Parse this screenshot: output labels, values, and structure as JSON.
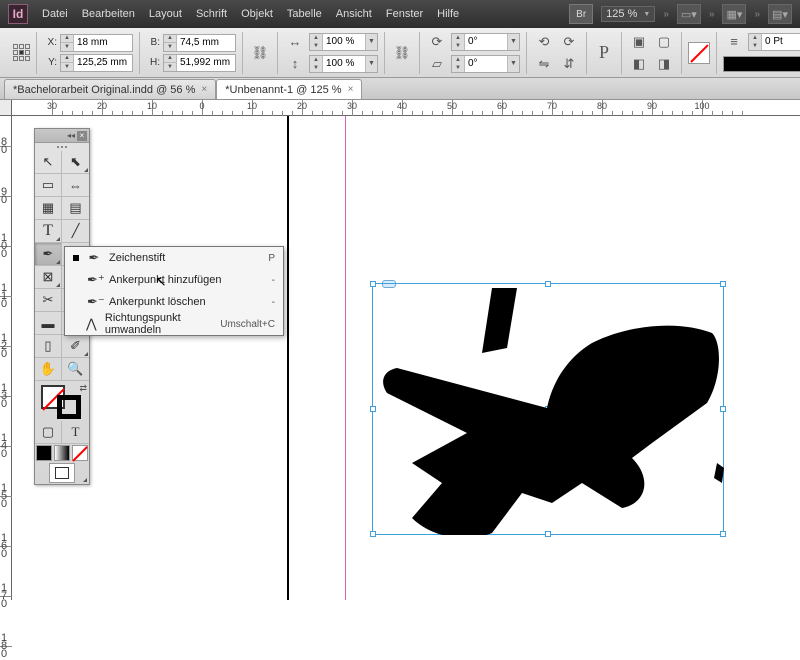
{
  "app": {
    "logo": "Id"
  },
  "menu": [
    "Datei",
    "Bearbeiten",
    "Layout",
    "Schrift",
    "Objekt",
    "Tabelle",
    "Ansicht",
    "Fenster",
    "Hilfe"
  ],
  "titlebar": {
    "br": "Br",
    "zoom": "125 %"
  },
  "control": {
    "x_label": "X:",
    "x": "18 mm",
    "y_label": "Y:",
    "y": "125,25 mm",
    "w_label": "B:",
    "w": "74,5 mm",
    "h_label": "H:",
    "h": "51,992 mm",
    "sx": "100 %",
    "sy": "100 %",
    "rot": "0°",
    "shear": "0°",
    "stroke_w": "0 Pt"
  },
  "tabs": [
    {
      "label": "*Bachelorarbeit Original.indd @ 56 %",
      "active": false
    },
    {
      "label": "*Unbenannt-1 @ 125 %",
      "active": true
    }
  ],
  "ruler_h": [
    -30,
    -20,
    -10,
    0,
    10,
    20,
    30,
    40,
    50,
    60,
    70,
    80,
    90,
    100
  ],
  "ruler_v": [
    80,
    90,
    100,
    110,
    120,
    130,
    140,
    150,
    160,
    170,
    180
  ],
  "flyout": {
    "items": [
      {
        "label": "Zeichenstift",
        "key": "P",
        "checked": true
      },
      {
        "label": "Ankerpunkt hinzufügen",
        "key": "-",
        "checked": false
      },
      {
        "label": "Ankerpunkt löschen",
        "key": "-",
        "checked": false
      },
      {
        "label": "Richtungspunkt umwandeln",
        "key": "Umschalt+C",
        "checked": false
      }
    ]
  }
}
